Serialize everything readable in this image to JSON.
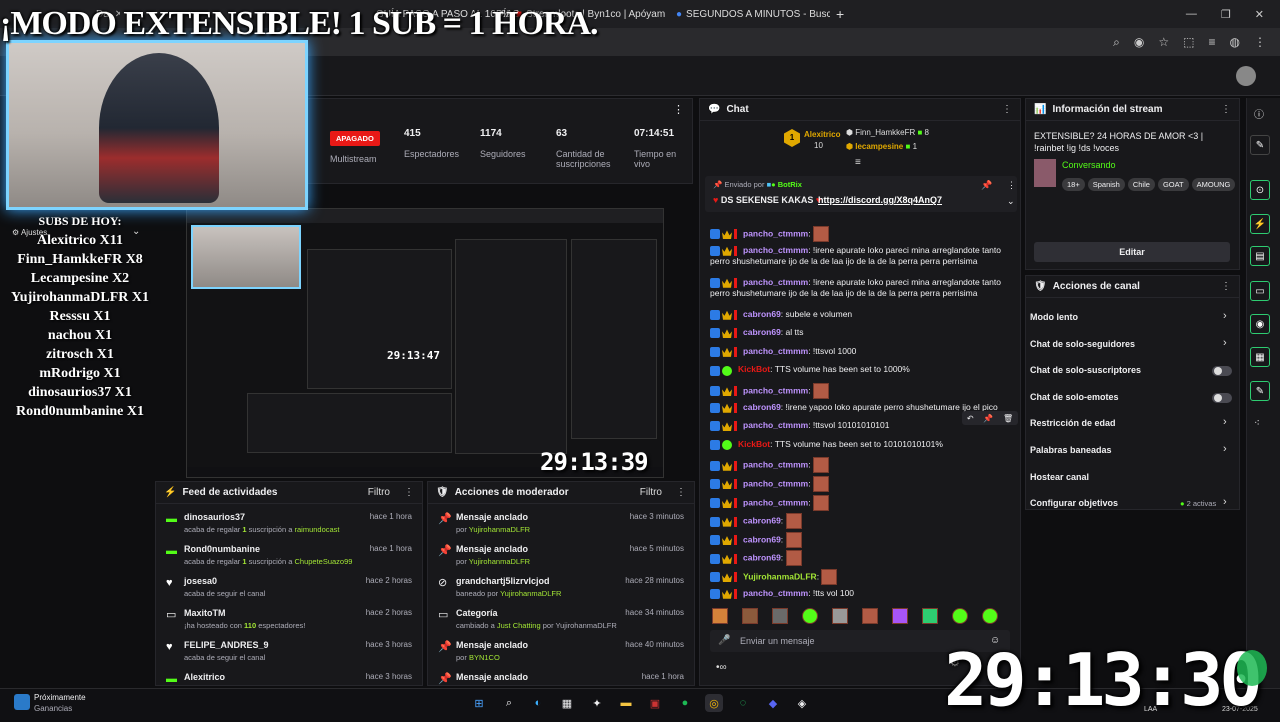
{
  "browser": {
    "tabs": [
      {
        "label": "Da",
        "close": "✕"
      },
      {
        "label": "DÍAS de cumpleaños",
        "close": "✕"
      },
      {
        "label": "GUÍA PASO A PASO AL 100% | I",
        "close": "✕"
      },
      {
        "label": "Streamloots | Byn1co | Apóyam",
        "close": "✕"
      },
      {
        "label": "SEGUNDOS A MINUTOS - Busc",
        "close": "✕"
      }
    ],
    "new_tab": "+"
  },
  "overlay": {
    "banner": "¡MODO EXTENSIBLE! 1 SUB = 1 HORA.",
    "subs_title": "SUBS DE HOY:",
    "subs": [
      "Alexitrico X11",
      "Finn_HamkkeFR X8",
      "Lecampesine X2",
      "YujirohanmaDLFR X1",
      "Resssu X1",
      "nachou X1",
      "zitrosch X1",
      "mRodrigo X1",
      "dinosaurios37 X1",
      "Rond0numbanine X1"
    ],
    "big_timer": "29:13:30",
    "preview_timer": "29:13:39",
    "inner_timer": "29:13:47",
    "ajustes": "Ajustes"
  },
  "stream_stats": {
    "status": "APAGADO",
    "status_label": "Multistream",
    "stats": [
      {
        "value": "415",
        "label": "Espectadores"
      },
      {
        "value": "1174",
        "label": "Seguidores"
      },
      {
        "value": "63",
        "label": "Cantidad de suscripciones"
      },
      {
        "value": "07:14:51",
        "label": "Tiempo en vivo"
      }
    ]
  },
  "activity_feed": {
    "title": "Feed de actividades",
    "filter": "Filtro",
    "items": [
      {
        "name": "dinosaurios37",
        "time": "hace 1 hora",
        "pre": "acaba de regalar ",
        "count": "1",
        "mid": " suscripción a ",
        "target": "raimundocast"
      },
      {
        "name": "Rond0numbanine",
        "time": "hace 1 hora",
        "pre": "acaba de regalar ",
        "count": "1",
        "mid": " suscripción a ",
        "target": "ChupeteSuazo99"
      },
      {
        "name": "josesa0",
        "time": "hace 2 horas",
        "pre": "acaba de seguir el canal",
        "count": "",
        "mid": "",
        "target": ""
      },
      {
        "name": "MaxitoTM",
        "time": "hace 2 horas",
        "pre": "¡ha hosteado con ",
        "count": "110",
        "mid": " espectadores!",
        "target": ""
      },
      {
        "name": "FELIPE_ANDRES_9",
        "time": "hace 3 horas",
        "pre": "acaba de seguir el canal",
        "count": "",
        "mid": "",
        "target": ""
      },
      {
        "name": "Alexitrico",
        "time": "hace 3 horas",
        "pre": "",
        "count": "",
        "mid": "",
        "target": ""
      }
    ]
  },
  "mod_actions": {
    "title": "Acciones de moderador",
    "filter": "Filtro",
    "items": [
      {
        "name": "Mensaje anclado",
        "time": "hace 3 minutos",
        "pre": "por ",
        "target": "YujirohanmaDLFR",
        "post": ""
      },
      {
        "name": "Mensaje anclado",
        "time": "hace 5 minutos",
        "pre": "por ",
        "target": "YujirohanmaDLFR",
        "post": ""
      },
      {
        "name": "grandchartj5lizrvlcjod",
        "time": "hace 28 minutos",
        "pre": "baneado por ",
        "target": "YujirohanmaDLFR",
        "post": ""
      },
      {
        "name": "Categoría",
        "time": "hace 34 minutos",
        "pre": "cambiado a ",
        "target": "Just Chatting",
        "post": " por YujirohanmaDLFR"
      },
      {
        "name": "Mensaje anclado",
        "time": "hace 40 minutos",
        "pre": "por ",
        "target": "BYN1CO",
        "post": ""
      },
      {
        "name": "Mensaje anclado",
        "time": "hace 1 hora",
        "pre": "",
        "target": "",
        "post": ""
      }
    ]
  },
  "chat": {
    "title": "Chat",
    "top_users": [
      {
        "name": "Alexitrico",
        "count": "10"
      },
      {
        "name": "Finn_HamkkeFR",
        "count": "8"
      },
      {
        "name": "lecampesine",
        "count": "1"
      }
    ],
    "pinned": {
      "by": "Enviado por",
      "bot": "BotRix",
      "text": "DS SEKENSE KAKAS",
      "link": "https://discord.gg/X8q4AnQ7"
    },
    "messages": [
      {
        "user": "pancho_ctmmm",
        "text": "",
        "emote": true,
        "color": "#bf94ff"
      },
      {
        "user": "pancho_ctmmm",
        "text": "!irene apurate loko pareci mina arreglandote tanto",
        "emote": false,
        "color": "#bf94ff",
        "cont": "perro shushetumare ijo de la de laa ijo de la de la perra perra perrisima"
      },
      {
        "user": "pancho_ctmmm",
        "text": "!irene apurate loko pareci mina arreglandote tanto",
        "emote": false,
        "color": "#bf94ff",
        "cont": "perro shushetumare ijo de la de laa ijo de la de la perra perra perrisima"
      },
      {
        "user": "cabron69",
        "text": "subele e volumen",
        "emote": false,
        "color": "#bf94ff"
      },
      {
        "user": "cabron69",
        "text": "al tts",
        "emote": false,
        "color": "#bf94ff"
      },
      {
        "user": "pancho_ctmmm",
        "text": "!ttsvol 1000",
        "emote": false,
        "color": "#bf94ff"
      },
      {
        "user": "KickBot",
        "text": "TTS volume has been set to 1000%",
        "emote": false,
        "color": "#e91916"
      },
      {
        "user": "pancho_ctmmm",
        "text": "",
        "emote": true,
        "color": "#bf94ff"
      },
      {
        "user": "cabron69",
        "text": "!irene yapoo loko apurate perro shushetumare ijo el pico",
        "emote": false,
        "color": "#bf94ff"
      },
      {
        "user": "pancho_ctmmm",
        "text": "!ttsvol 10101010101",
        "emote": false,
        "color": "#bf94ff"
      },
      {
        "user": "KickBot",
        "text": "TTS volume has been set to 10101010101%",
        "emote": false,
        "color": "#e91916"
      },
      {
        "user": "pancho_ctmmm",
        "text": "",
        "emote": true,
        "color": "#bf94ff"
      },
      {
        "user": "pancho_ctmmm",
        "text": "",
        "emote": true,
        "color": "#bf94ff"
      },
      {
        "user": "pancho_ctmmm",
        "text": "",
        "emote": true,
        "color": "#bf94ff"
      },
      {
        "user": "cabron69",
        "text": "",
        "emote": true,
        "color": "#bf94ff"
      },
      {
        "user": "cabron69",
        "text": "",
        "emote": true,
        "color": "#bf94ff"
      },
      {
        "user": "cabron69",
        "text": "",
        "emote": true,
        "color": "#bf94ff"
      },
      {
        "user": "YujirohanmaDLFR",
        "text": "",
        "emote": true,
        "color": "#a3e635"
      },
      {
        "user": "pancho_ctmmm",
        "text": "!tts vol 100",
        "emote": false,
        "color": "#bf94ff"
      }
    ],
    "input_placeholder": "Enviar un mensaje"
  },
  "stream_info": {
    "title": "Información del stream",
    "stream_title": "EXTENSIBLE? 24 HORAS DE AMOR <3 | !rainbet !ig !ds !voces",
    "category": "Conversando",
    "tags": [
      "18+",
      "Spanish",
      "Chile",
      "GOAT",
      "AMOUNG"
    ],
    "edit": "Editar"
  },
  "channel_actions": {
    "title": "Acciones de canal",
    "items": [
      {
        "label": "Modo lento",
        "kind": "chevron"
      },
      {
        "label": "Chat de solo-seguidores",
        "kind": "chevron"
      },
      {
        "label": "Chat de solo-suscriptores",
        "kind": "toggle"
      },
      {
        "label": "Chat de solo-emotes",
        "kind": "toggle"
      },
      {
        "label": "Restricción de edad",
        "kind": "chevron"
      },
      {
        "label": "Palabras baneadas",
        "kind": "chevron"
      },
      {
        "label": "Hostear canal",
        "kind": "none"
      },
      {
        "label": "Configurar objetivos",
        "kind": "chevron",
        "extra": "2 activas"
      }
    ]
  },
  "taskbar": {
    "notification_title": "Próximamente",
    "notification_sub": "Ganancias",
    "lang": "LAA",
    "date": "23-07-2025"
  },
  "colors": {
    "kick_green": "#53fc18",
    "accent": "#2ecc71",
    "bg": "#0e0e10",
    "panel": "#18181b"
  }
}
